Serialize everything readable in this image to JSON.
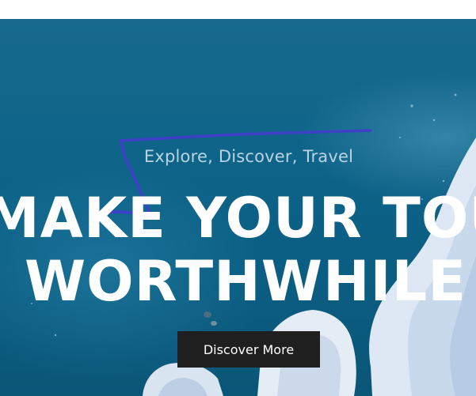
{
  "hero": {
    "subtitle": "Explore, Discover, Travel",
    "headline_line1": "MAKE YOUR TOUR",
    "headline_line2": "WORTHWHILE",
    "cta_label": "Discover More"
  },
  "colors": {
    "water": "#0e6489",
    "ice": "#e6eef7",
    "button": "#1f1f1f",
    "scribble": "#3f3fc8"
  }
}
